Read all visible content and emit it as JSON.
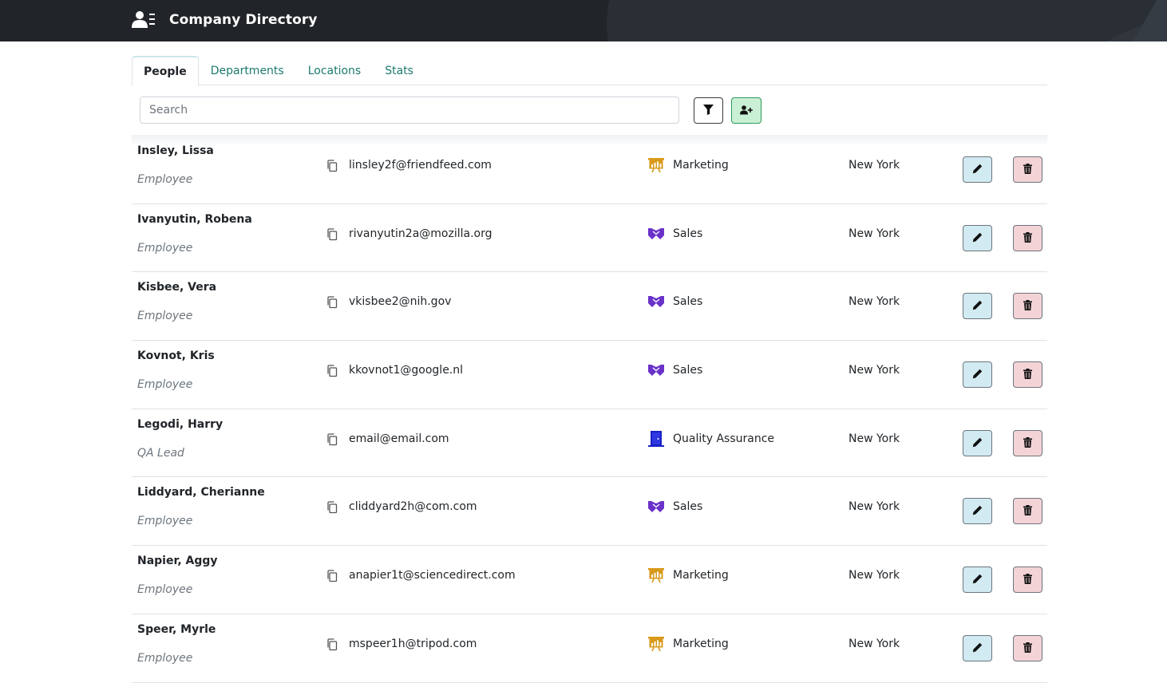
{
  "header": {
    "title": "Company Directory",
    "icon": "address-book-icon"
  },
  "tabs": [
    {
      "label": "People",
      "active": true
    },
    {
      "label": "Departments",
      "active": false
    },
    {
      "label": "Locations",
      "active": false
    },
    {
      "label": "Stats",
      "active": false
    }
  ],
  "search": {
    "placeholder": "Search",
    "value": ""
  },
  "toolbar": {
    "filter_icon": "filter-icon",
    "add_icon": "user-plus-icon"
  },
  "colors": {
    "header_bg": "#212529",
    "tab_link": "#1b7a6e",
    "edit_btn": "#d2eaf2",
    "delete_btn": "#f4d3d6",
    "add_btn": "#c9f0d5",
    "marketing": "#d99a1c",
    "sales": "#6a32c9",
    "qa": "#1a22c4"
  },
  "people": [
    {
      "name": "Insley, Lissa",
      "job": "Employee",
      "email": "linsley2f@friendfeed.com",
      "department": "Marketing",
      "dept_icon": "presentation-chart-icon",
      "location": "New York"
    },
    {
      "name": "Ivanyutin, Robena",
      "job": "Employee",
      "email": "rivanyutin2a@mozilla.org",
      "department": "Sales",
      "dept_icon": "handshake-icon",
      "location": "New York"
    },
    {
      "name": "Kisbee, Vera",
      "job": "Employee",
      "email": "vkisbee2@nih.gov",
      "department": "Sales",
      "dept_icon": "handshake-icon",
      "location": "New York"
    },
    {
      "name": "Kovnot, Kris",
      "job": "Employee",
      "email": "kkovnot1@google.nl",
      "department": "Sales",
      "dept_icon": "handshake-icon",
      "location": "New York"
    },
    {
      "name": "Legodi, Harry",
      "job": "QA Lead",
      "email": "email@email.com",
      "department": "Quality Assurance",
      "dept_icon": "door-icon",
      "location": "New York"
    },
    {
      "name": "Liddyard, Cherianne",
      "job": "Employee",
      "email": "cliddyard2h@com.com",
      "department": "Sales",
      "dept_icon": "handshake-icon",
      "location": "New York"
    },
    {
      "name": "Napier, Aggy",
      "job": "Employee",
      "email": "anapier1t@sciencedirect.com",
      "department": "Marketing",
      "dept_icon": "presentation-chart-icon",
      "location": "New York"
    },
    {
      "name": "Speer, Myrle",
      "job": "Employee",
      "email": "mspeer1h@tripod.com",
      "department": "Marketing",
      "dept_icon": "presentation-chart-icon",
      "location": "New York"
    }
  ]
}
